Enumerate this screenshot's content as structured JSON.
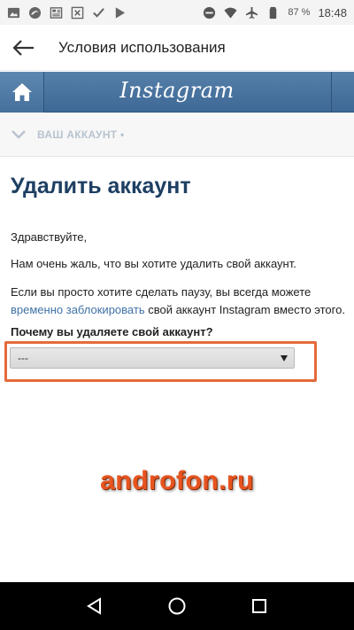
{
  "status_bar": {
    "left_icons": [
      "photo-icon",
      "browser-icon",
      "news-icon",
      "cross-box-icon",
      "check-icon",
      "play-store-icon"
    ],
    "right_icons": [
      "dnd-icon",
      "wifi-icon",
      "airplane-icon",
      "battery-icon"
    ],
    "battery": "87 %",
    "time": "18:48"
  },
  "app_bar": {
    "title": "Условия использования"
  },
  "instagram_header": {
    "logo": "Instagram"
  },
  "breadcrumb": {
    "label": "ВАШ АККАУНТ •"
  },
  "main": {
    "title": "Удалить аккаунт",
    "greeting": "Здравствуйте,",
    "sorry_text": "Нам очень жаль, что вы хотите удалить свой аккаунт.",
    "pause_text": "Если вы просто хотите сделать паузу, вы всегда можете",
    "pause_link": "временно заблокировать",
    "pause_rest": " свой аккаунт Instagram вместо этого.",
    "question": "Почему вы удаляете свой аккаунт?",
    "reason_select": "---"
  },
  "watermark": "androfon.ru",
  "colors": {
    "accent": "#3f6896",
    "title": "#1e3f63",
    "link": "#3f72a6",
    "highlight": "#e46a3a",
    "watermark": "#e8541f"
  }
}
